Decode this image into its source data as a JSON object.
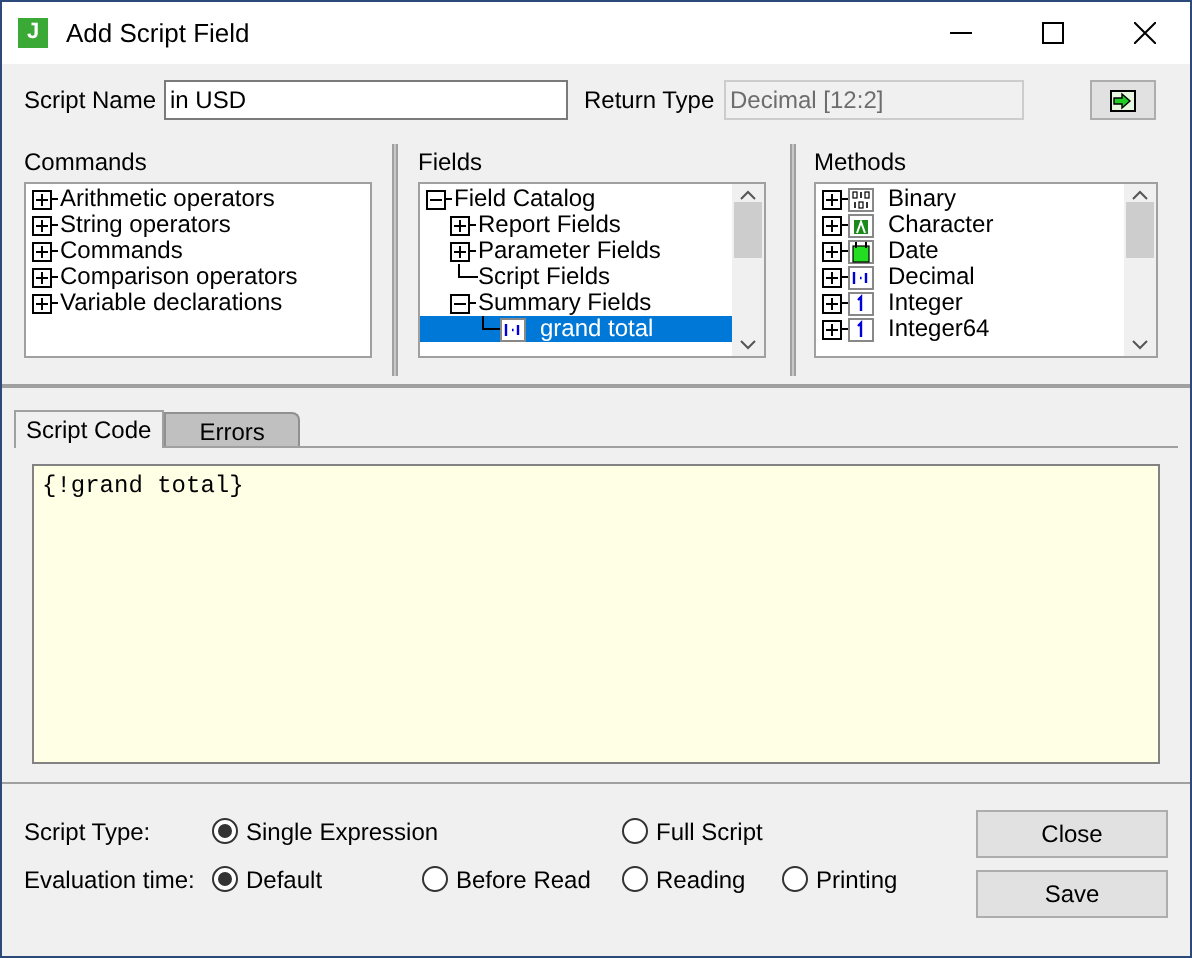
{
  "window": {
    "title": "Add Script Field",
    "logo": "J"
  },
  "script_name": {
    "label": "Script Name",
    "value": "in USD"
  },
  "return_type": {
    "label": "Return Type",
    "value": "Decimal [12:2]",
    "disabled": true
  },
  "commands": {
    "label": "Commands",
    "items": [
      {
        "label": "Arithmetic operators",
        "expanded": false
      },
      {
        "label": "String operators",
        "expanded": false
      },
      {
        "label": "Commands",
        "expanded": false
      },
      {
        "label": "Comparison operators",
        "expanded": false
      },
      {
        "label": "Variable declarations",
        "expanded": false
      }
    ]
  },
  "fields": {
    "label": "Fields",
    "items": [
      {
        "label": "Field Catalog",
        "expanded": true,
        "children": [
          {
            "label": "Report Fields",
            "expanded": false
          },
          {
            "label": "Parameter Fields",
            "expanded": false
          },
          {
            "label": "Script Fields"
          },
          {
            "label": "Summary Fields",
            "expanded": true,
            "children": [
              {
                "label": "grand total",
                "kind": "decimal",
                "selected": true
              }
            ]
          }
        ]
      }
    ]
  },
  "methods": {
    "label": "Methods",
    "items": [
      {
        "label": "Binary",
        "kind": "binary",
        "expanded": false
      },
      {
        "label": "Character",
        "kind": "character",
        "expanded": false
      },
      {
        "label": "Date",
        "kind": "date",
        "expanded": false
      },
      {
        "label": "Decimal",
        "kind": "decimal",
        "expanded": false
      },
      {
        "label": "Integer",
        "kind": "integer",
        "expanded": false
      },
      {
        "label": "Integer64",
        "kind": "integer",
        "expanded": false
      }
    ]
  },
  "tabs": [
    {
      "label": "Script Code",
      "selected": true
    },
    {
      "label": "Errors",
      "selected": false
    }
  ],
  "script_code": "{!grand total}",
  "script_type": {
    "label": "Script Type:",
    "options": [
      {
        "label": "Single Expression",
        "selected": true
      },
      {
        "label": "Full Script",
        "selected": false
      }
    ]
  },
  "evaluation_time": {
    "label": "Evaluation time:",
    "options": [
      {
        "label": "Default",
        "selected": true
      },
      {
        "label": "Before Read",
        "selected": false
      },
      {
        "label": "Reading",
        "selected": false
      },
      {
        "label": "Printing",
        "selected": false
      }
    ]
  },
  "buttons": [
    "Close",
    "Save"
  ]
}
